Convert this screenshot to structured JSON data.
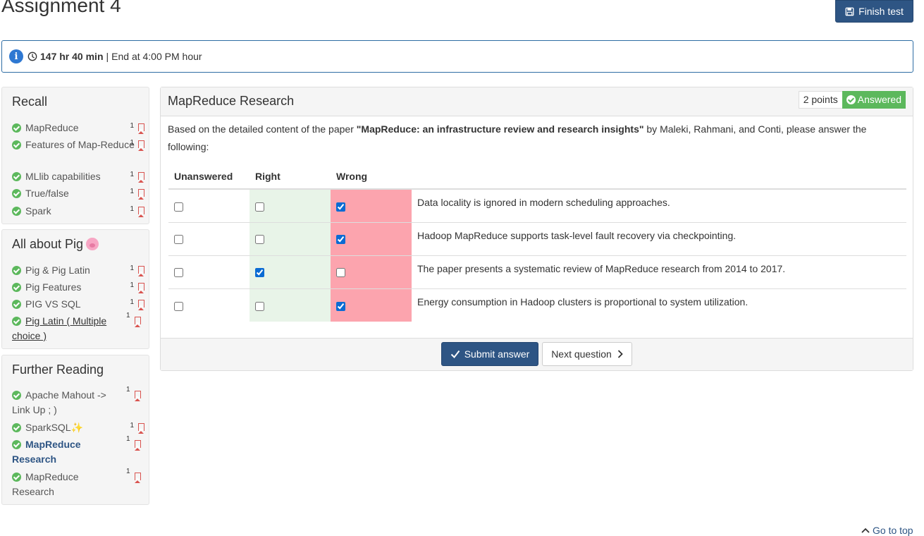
{
  "page": {
    "title": "Assignment 4"
  },
  "header": {
    "finish_label": "Finish test"
  },
  "timer": {
    "remaining": "147 hr 40 min",
    "separator": "|",
    "end_text": "End at 4:00 PM hour"
  },
  "sidebar": {
    "sections": [
      {
        "title": "Recall",
        "items": [
          {
            "label": "MapReduce",
            "count": "1"
          },
          {
            "label": "Features of Map-Reduce",
            "count": "1"
          },
          {
            "label": "MLlib capabilities",
            "count": "1"
          },
          {
            "label": "True/false",
            "count": "1"
          },
          {
            "label": "Spark",
            "count": "1"
          }
        ]
      },
      {
        "title": "All about Pig",
        "items": [
          {
            "label": "Pig & Pig Latin",
            "count": "1"
          },
          {
            "label": "Pig Features",
            "count": "1"
          },
          {
            "label": "PIG VS SQL",
            "count": "1"
          },
          {
            "label": "Pig Latin ( Multiple choice )",
            "count": "1"
          }
        ]
      },
      {
        "title": "Further Reading",
        "items": [
          {
            "label": "Apache Mahout -> Link Up ; )",
            "count": "1"
          },
          {
            "label": "SparkSQL✨",
            "count": "1"
          },
          {
            "label": "MapReduce Research",
            "count": "1"
          },
          {
            "label": "MapReduce Research",
            "count": "1"
          }
        ]
      }
    ]
  },
  "question": {
    "title": "MapReduce Research",
    "points": "2 points",
    "status": "Answered",
    "text_before": "Based on the detailed content of the paper ",
    "paper_title": "\"MapReduce: an infrastructure review and research insights\"",
    "text_after": " by Maleki, Rahmani, and Conti, please answer the following:",
    "columns": [
      "Unanswered",
      "Right",
      "Wrong"
    ],
    "rows": [
      {
        "statement": "Data locality is ignored in modern scheduling approaches.",
        "selected": "Wrong"
      },
      {
        "statement": "Hadoop MapReduce supports task-level fault recovery via checkpointing.",
        "selected": "Wrong"
      },
      {
        "statement": "The paper presents a systematic review of MapReduce research from 2014 to 2017.",
        "selected": "Right"
      },
      {
        "statement": "Energy consumption in Hadoop clusters is proportional to system utilization.",
        "selected": "Wrong"
      }
    ]
  },
  "footer": {
    "submit_label": "Submit answer",
    "next_label": "Next question"
  },
  "go_top": "Go to top",
  "colors": {
    "primary": "#2e5584",
    "success": "#5cb85c",
    "right_bg": "#e8f4e8",
    "wrong_bg": "#fca4ae",
    "bookmark": "#d9534f"
  }
}
